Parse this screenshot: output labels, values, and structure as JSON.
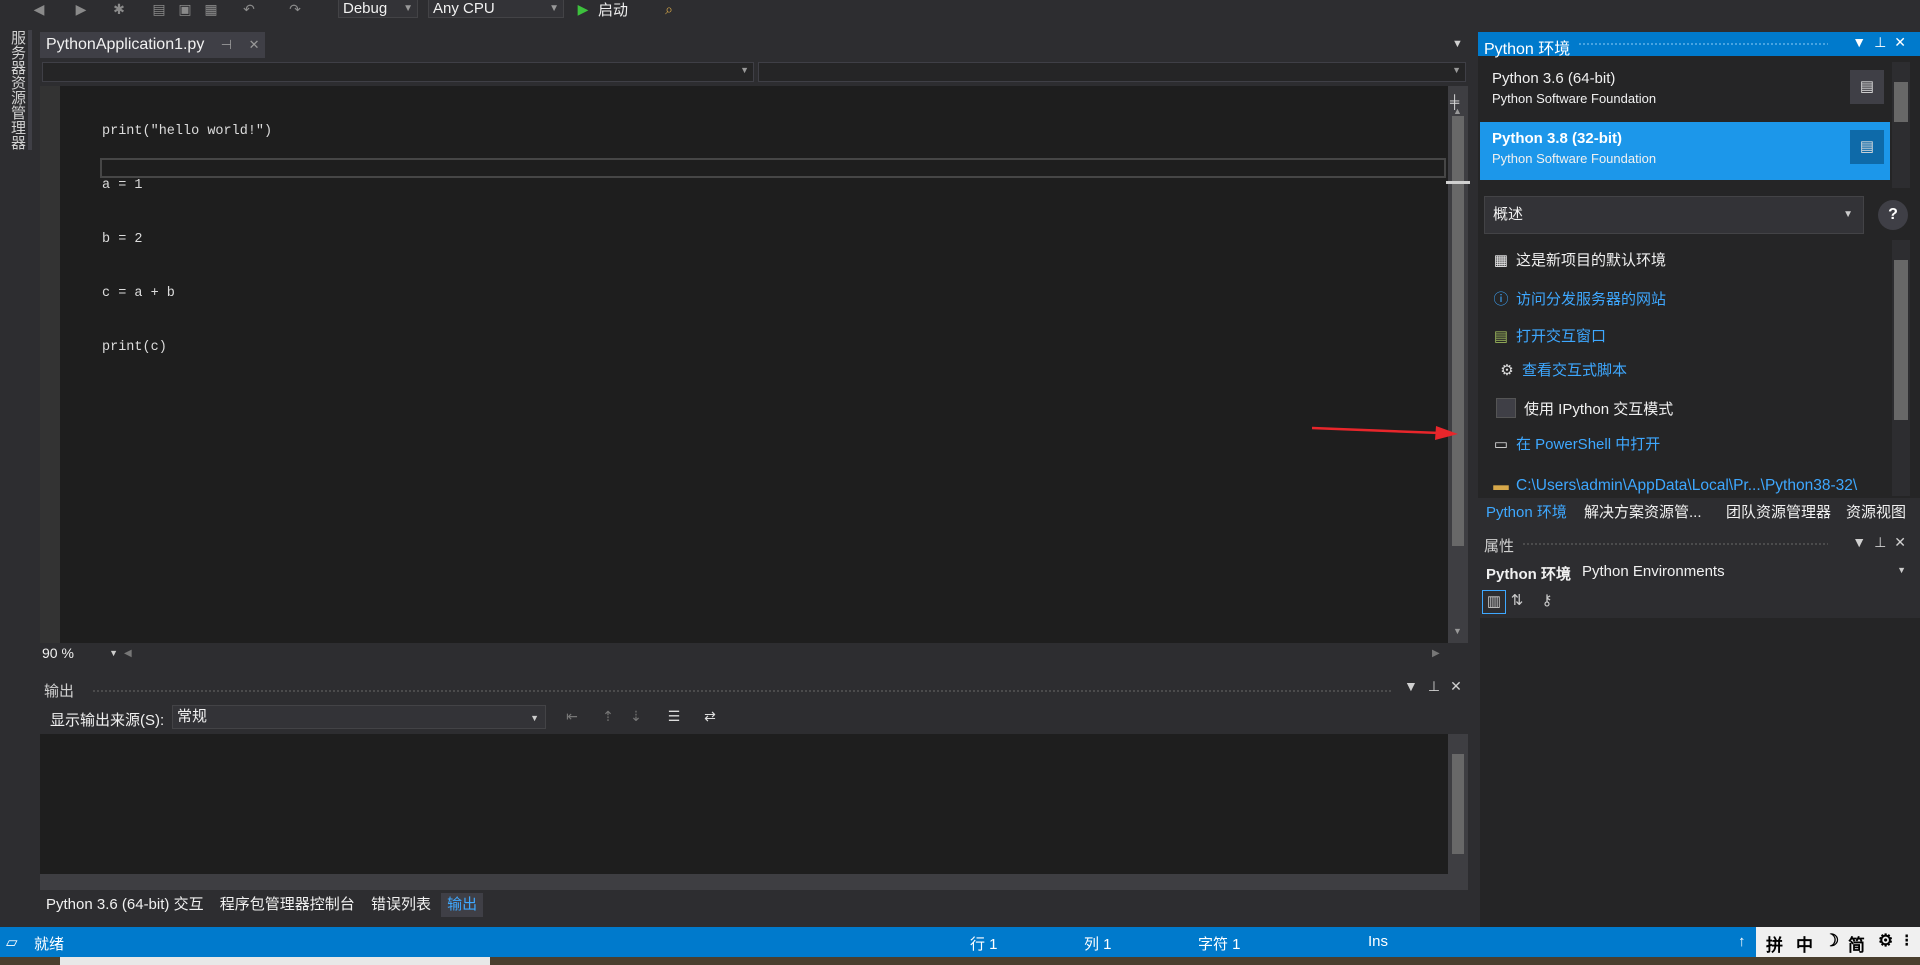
{
  "toolbar": {
    "configuration": "Debug",
    "platform": "Any CPU",
    "start_label": "启动"
  },
  "left_strip": {
    "server_explorer": "服务器资源管理器"
  },
  "document": {
    "tab_title": "PythonApplication1.py",
    "code_lines": [
      "print(\"hello world!\")",
      "a = 1",
      "b = 2",
      "c = a + b",
      "print(c)"
    ],
    "zoom": "90 %"
  },
  "output": {
    "title": "输出",
    "source_label": "显示输出来源(S):",
    "source_value": "常规"
  },
  "bottom_tabs": [
    {
      "label": "Python 3.6 (64-bit) 交互"
    },
    {
      "label": "程序包管理器控制台"
    },
    {
      "label": "错误列表"
    },
    {
      "label": "输出"
    }
  ],
  "python_env": {
    "title": "Python 环境",
    "environments": [
      {
        "name": "Python 3.6 (64-bit)",
        "org": "Python Software Foundation"
      },
      {
        "name": "Python 3.8 (32-bit)",
        "org": "Python Software Foundation"
      }
    ],
    "view": "概述",
    "default_env_text": "这是新项目的默认环境",
    "links": {
      "visit_site": "访问分发服务器的网站",
      "open_interactive": "打开交互窗口",
      "view_scripts": "查看交互式脚本",
      "use_ipython": "使用 IPython 交互模式",
      "open_powershell": "在 PowerShell 中打开",
      "path": "C:\\Users\\admin\\AppData\\Local\\Pr...\\Python38-32\\"
    }
  },
  "right_tabs": [
    "Python 环境",
    "解决方案资源管...",
    "团队资源管理器",
    "资源视图"
  ],
  "properties": {
    "title": "属性",
    "object_name": "Python 环境",
    "object_type": "Python Environments"
  },
  "status": {
    "ready": "就绪",
    "line": "行 1",
    "col": "列 1",
    "char": "字符 1",
    "mode": "Ins"
  },
  "ime": {
    "chars": [
      "拼",
      "中",
      "简"
    ]
  },
  "colors": {
    "accent": "#007acc",
    "selected_env": "#1c97ea",
    "link": "#3ea8ff"
  }
}
